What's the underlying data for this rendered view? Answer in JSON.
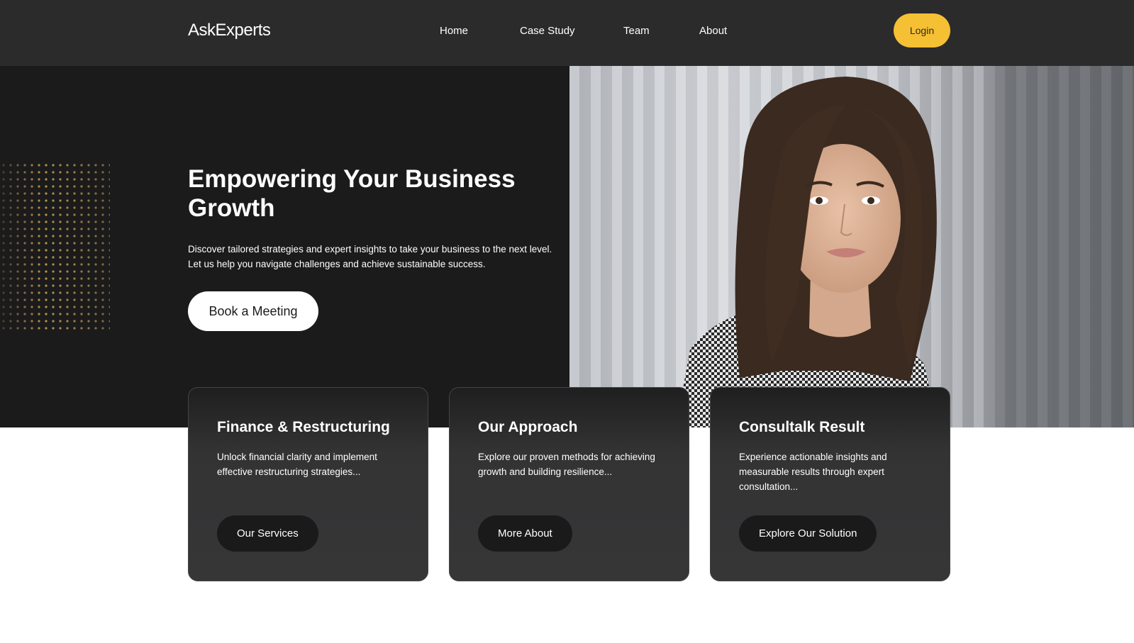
{
  "header": {
    "logo": "AskExperts",
    "nav": [
      {
        "label": "Home"
      },
      {
        "label": "Case Study"
      },
      {
        "label": "Team"
      },
      {
        "label": "About"
      }
    ],
    "login_label": "Login"
  },
  "hero": {
    "title": "Empowering Your Business Growth",
    "description": "Discover tailored strategies and expert insights to take your business to the next level. Let us help you navigate challenges and achieve sustainable success.",
    "cta_label": "Book a Meeting"
  },
  "cards": [
    {
      "title": "Finance & Restructuring",
      "description": "Unlock financial clarity and implement effective restructuring strategies...",
      "button_label": "Our Services"
    },
    {
      "title": "Our Approach",
      "description": "Explore our proven methods for achieving growth and building resilience...",
      "button_label": "More About"
    },
    {
      "title": "Consultalk Result",
      "description": "Experience actionable insights and measurable results through expert consultation...",
      "button_label": "Explore Our Solution"
    }
  ],
  "colors": {
    "header_bg": "#2b2b2b",
    "hero_bg": "#1b1b1c",
    "accent": "#f5c033",
    "card_bg": "#363637"
  }
}
